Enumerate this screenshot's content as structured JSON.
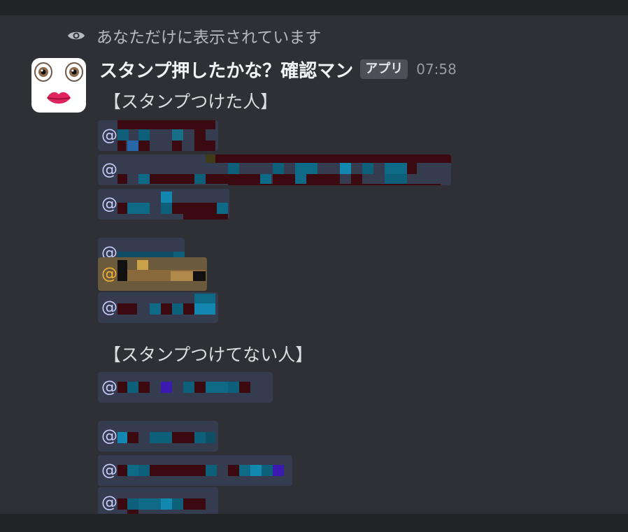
{
  "ephemeral_notice": {
    "icon": "eye-icon",
    "text": "あなただけに表示されています"
  },
  "message": {
    "author": "スタンプ押したかな？確認マン",
    "badge": "アプリ",
    "timestamp": "07:58",
    "avatar_icon": "face-eyes-lips-icon"
  },
  "sections": [
    {
      "heading": "【スタンプつけた人】",
      "mentions": [
        {
          "at": "@",
          "redacted": true,
          "highlight": false
        },
        {
          "at": "@",
          "redacted": true,
          "highlight": false
        },
        {
          "at": "@",
          "redacted": true,
          "highlight": false
        },
        {
          "at": "@",
          "redacted": true,
          "highlight": false
        },
        {
          "at": "@",
          "redacted": true,
          "highlight": true
        },
        {
          "at": "@",
          "redacted": true,
          "highlight": false
        }
      ]
    },
    {
      "heading": "【スタンプつけてない人】",
      "mentions": [
        {
          "at": "@",
          "redacted": true,
          "highlight": false
        },
        {
          "at": "@",
          "redacted": true,
          "highlight": false
        },
        {
          "at": "@",
          "redacted": true,
          "highlight": false
        },
        {
          "at": "@",
          "redacted": true,
          "highlight": false
        }
      ]
    }
  ],
  "colors": {
    "background": "#2b2d31",
    "mention_bg": "#363c50",
    "mention_text": "#c9cdfb",
    "highlight_bg": "#6b5a3c",
    "highlight_text": "#f0b232",
    "redaction_dark": "#3b0a10",
    "redaction_teal": "#0e6a87"
  }
}
